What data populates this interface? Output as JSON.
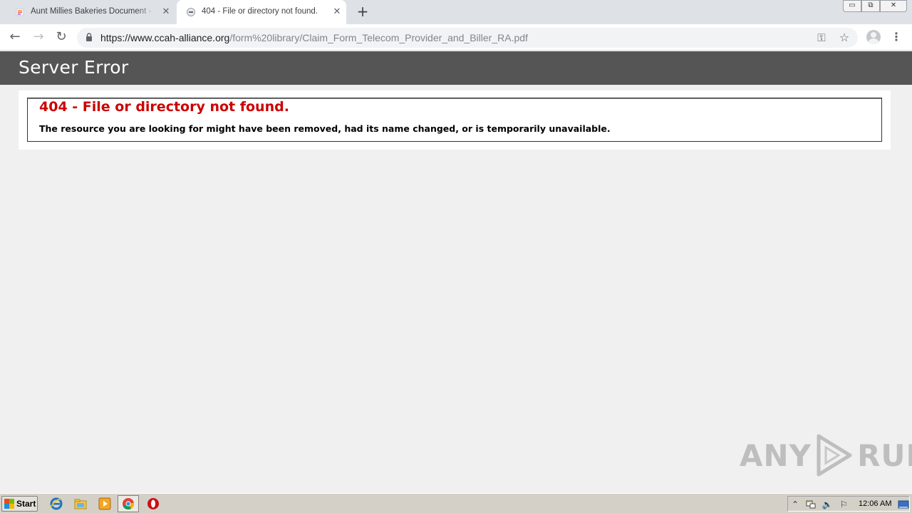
{
  "browser": {
    "tabs": [
      {
        "title": "Aunt Millies Bakeries Document - Slite",
        "active": false
      },
      {
        "title": "404 - File or directory not found.",
        "active": true
      }
    ],
    "tab_close_glyph": "✕",
    "new_tab_glyph": "+",
    "window_controls": {
      "minimize": "▭",
      "maximize": "⧉",
      "close": "✕"
    },
    "url_host": "https://www.ccah-alliance.org",
    "url_path": "/form%20library/Claim_Form_Telecom_Provider_and_Biller_RA.pdf",
    "icons": {
      "back": "←",
      "forward": "→",
      "reload": "↻",
      "key": "⚿",
      "star": "☆",
      "menu": "⋮"
    }
  },
  "page": {
    "header_title": "Server Error",
    "error_heading": "404 - File or directory not found.",
    "error_message": "The resource you are looking for might have been removed, had its name changed, or is temporarily unavailable."
  },
  "watermark": {
    "left_text": "ANY",
    "right_text": "RUN"
  },
  "taskbar": {
    "start_label": "Start",
    "clock": "12:06 AM",
    "tray_glyphs": {
      "chevron": "⌃",
      "volume": "🔈",
      "flag": "⚐"
    }
  },
  "colors": {
    "header_bg": "#555555",
    "error_red": "#cc0000",
    "page_bg": "#f0f0f0"
  }
}
